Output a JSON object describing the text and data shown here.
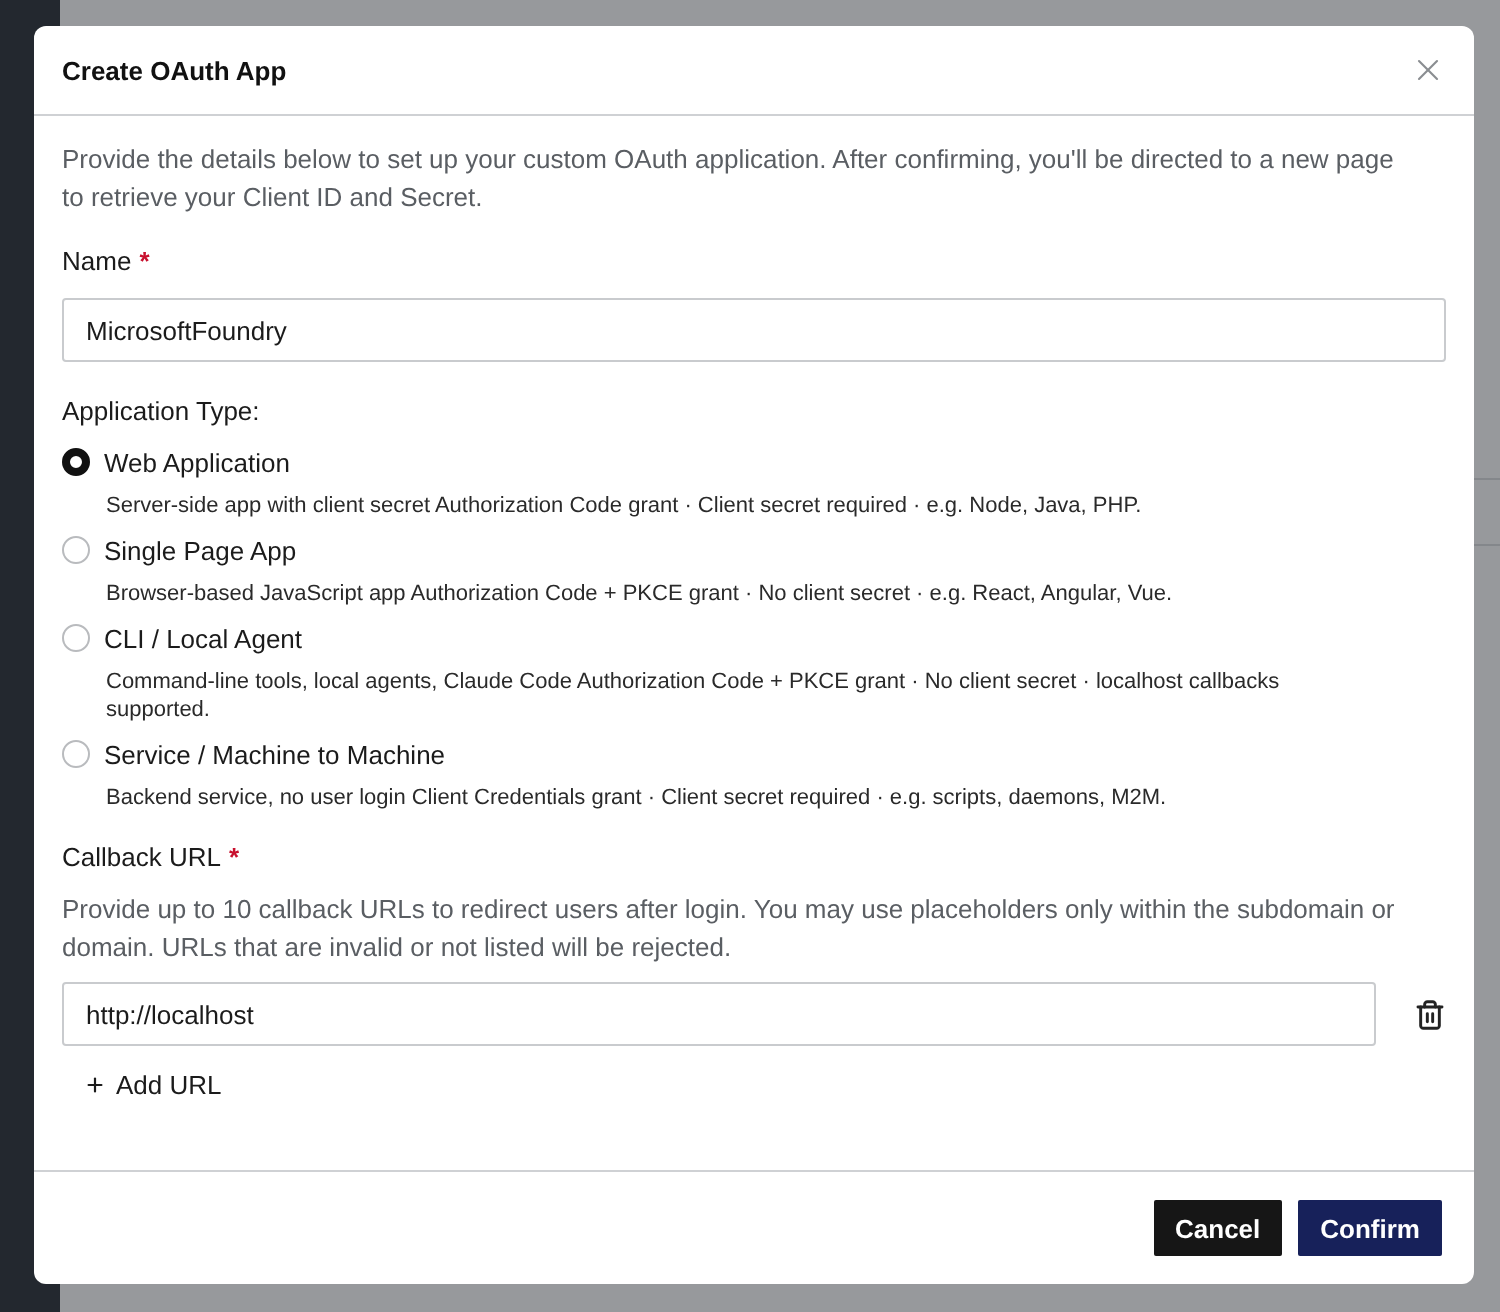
{
  "dialog": {
    "title": "Create OAuth App",
    "description": "Provide the details below to set up your custom OAuth application. After confirming, you'll be directed to a new page to retrieve your Client ID and Secret."
  },
  "name_field": {
    "label": "Name",
    "required_mark": "*",
    "value": "MicrosoftFoundry"
  },
  "application_type": {
    "label": "Application Type:",
    "options": [
      {
        "label": "Web Application",
        "description": "Server-side app with client secret Authorization Code grant · Client secret required · e.g. Node, Java, PHP.",
        "selected": true
      },
      {
        "label": "Single Page App",
        "description": "Browser-based JavaScript app Authorization Code + PKCE grant · No client secret · e.g. React, Angular, Vue.",
        "selected": false
      },
      {
        "label": "CLI / Local Agent",
        "description": "Command-line tools, local agents, Claude Code Authorization Code + PKCE grant · No client secret · localhost callbacks supported.",
        "selected": false
      },
      {
        "label": "Service / Machine to Machine",
        "description": "Backend service, no user login Client Credentials grant · Client secret required · e.g. scripts, daemons, M2M.",
        "selected": false
      }
    ]
  },
  "callback": {
    "label": "Callback URL",
    "required_mark": "*",
    "help": "Provide up to 10 callback URLs to redirect users after login. You may use placeholders only within the subdomain or domain. URLs that are invalid or not listed will be rejected.",
    "urls": [
      {
        "value": "http://localhost"
      }
    ],
    "add_label": "Add URL"
  },
  "buttons": [
    {
      "label": "Cancel",
      "kind": "secondary"
    },
    {
      "label": "Confirm",
      "kind": "primary"
    }
  ]
}
